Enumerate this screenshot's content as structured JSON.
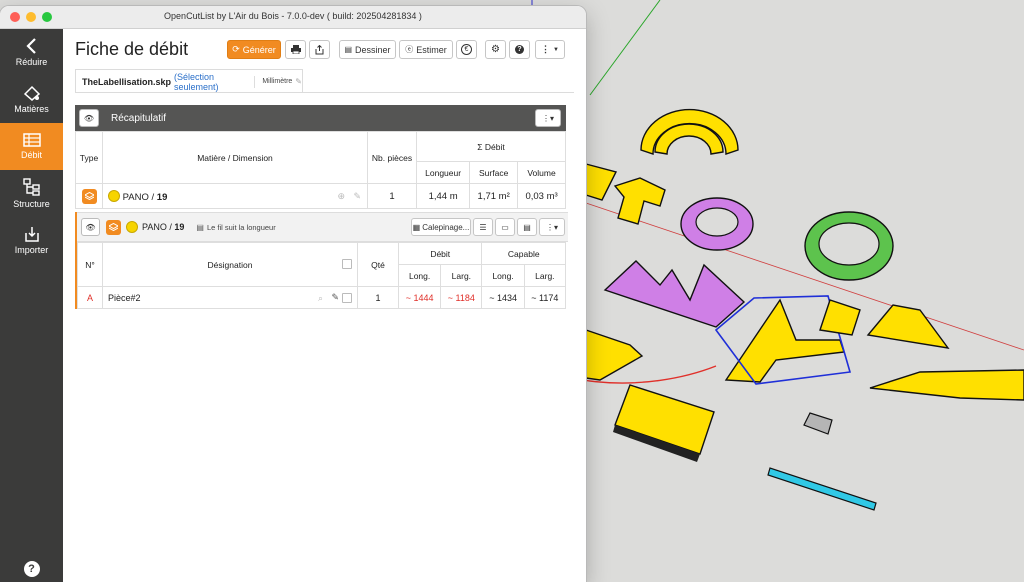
{
  "window": {
    "title": "OpenCutList by L'Air du Bois - 7.0.0-dev ( build: 202504281834 )"
  },
  "colors": {
    "accent": "#f18b21",
    "sidebar": "#3b3b3a",
    "panel_header": "#555554",
    "link": "#2a6fc9",
    "warn": "#e0302a",
    "material_dot": "#f7d400"
  },
  "sidebar": {
    "items": [
      {
        "label": "Réduire",
        "icon": "chevron-left-icon"
      },
      {
        "label": "Matières",
        "icon": "materials-icon"
      },
      {
        "label": "Débit",
        "icon": "cutlist-icon"
      },
      {
        "label": "Structure",
        "icon": "structure-icon"
      },
      {
        "label": "Importer",
        "icon": "import-icon"
      }
    ],
    "help": "?"
  },
  "header": {
    "title": "Fiche de débit",
    "generate": "Générer",
    "draw": "Dessiner",
    "estimate": "Estimer",
    "currency_symbol": "€",
    "help_symbol": "?"
  },
  "file_tab": {
    "filename": "TheLabellisation.skp",
    "selection": "(Sélection seulement)",
    "unit": "Millimètre"
  },
  "summary": {
    "title": "Récapitulatif",
    "headers": {
      "type": "Type",
      "material": "Matière / Dimension",
      "count": "Nb. pièces",
      "total": "Σ Débit",
      "length": "Longueur",
      "surface": "Surface",
      "volume": "Volume"
    },
    "row": {
      "material": "PANO",
      "dim": "19",
      "count": "1",
      "length": "1,44 m",
      "surface": "1,71 m²",
      "volume": "0,03 m³"
    }
  },
  "group": {
    "material": "PANO",
    "dim": "19",
    "grain_note": "Le fil suit la longueur",
    "layout_btn": "Calepinage...",
    "headers": {
      "num": "N°",
      "designation": "Désignation",
      "qty": "Qté",
      "cut": "Débit",
      "final": "Capable",
      "length": "Long.",
      "width": "Larg."
    },
    "row": {
      "num": "A",
      "name": "Pièce#2",
      "qty": "1",
      "cut_length": "~ 1444",
      "cut_width": "~ 1184",
      "final_length": "~ 1434",
      "final_width": "~ 1174"
    }
  }
}
